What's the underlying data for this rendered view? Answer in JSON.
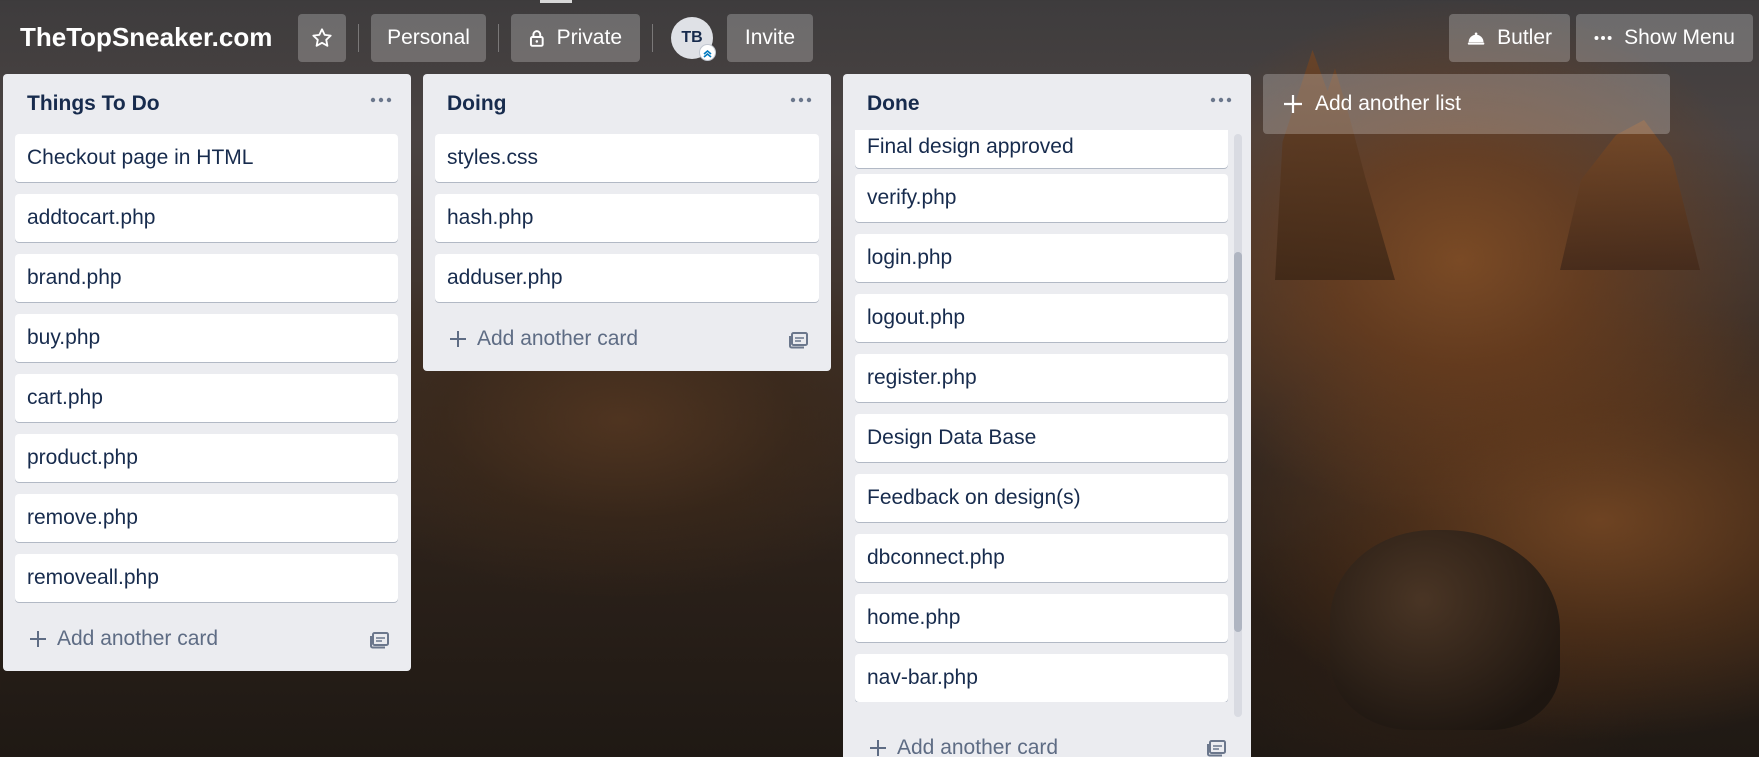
{
  "board": {
    "title": "TheTopSneaker.com",
    "visibility_team": "Personal",
    "visibility": "Private",
    "member_initials": "TB",
    "invite_label": "Invite",
    "butler_label": "Butler",
    "show_menu_label": "Show Menu",
    "add_list_label": "Add another list"
  },
  "lists": [
    {
      "title": "Things To Do",
      "cards": [
        "Checkout page in HTML",
        "addtocart.php",
        "brand.php",
        "buy.php",
        "cart.php",
        "product.php",
        "remove.php",
        "removeall.php"
      ],
      "add_card_label": "Add another card"
    },
    {
      "title": "Doing",
      "cards": [
        "styles.css",
        "hash.php",
        "adduser.php"
      ],
      "add_card_label": "Add another card"
    },
    {
      "title": "Done",
      "cards": [
        "Final design approved",
        "verify.php",
        "login.php",
        "logout.php",
        "register.php",
        "Design Data Base",
        "Feedback on design(s)",
        "dbconnect.php",
        "home.php",
        "nav-bar.php"
      ],
      "add_card_label": "Add another card"
    }
  ],
  "icons": {
    "star": "star-icon",
    "lock": "lock-icon",
    "butler": "butler-icon",
    "menu": "more-icon",
    "plus": "plus-icon",
    "template": "card-template-icon"
  }
}
